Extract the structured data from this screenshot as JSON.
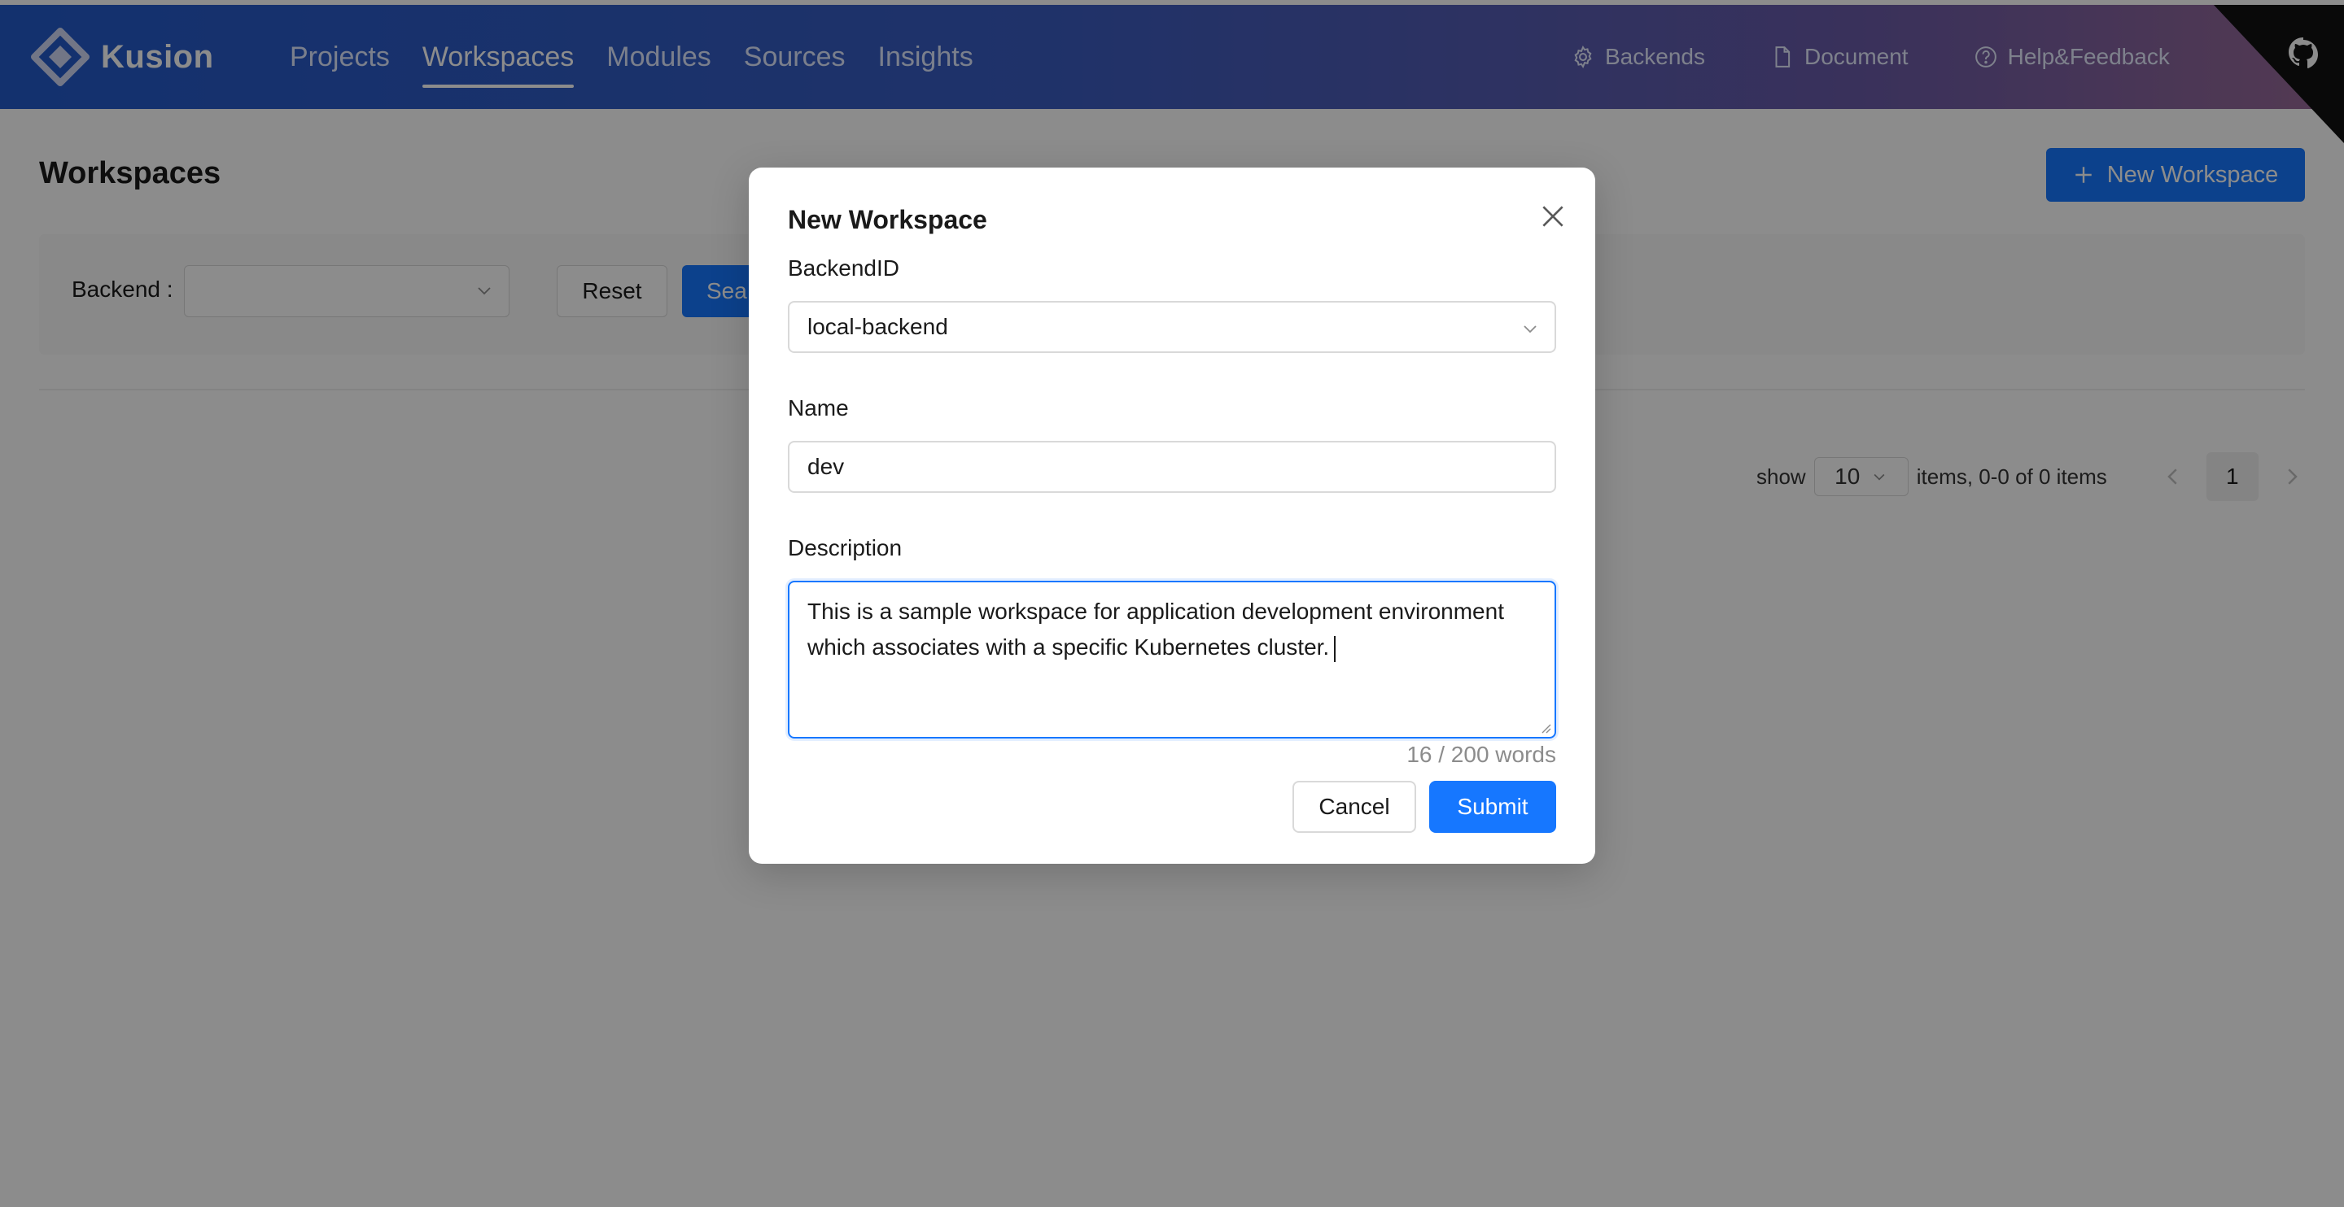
{
  "app": {
    "logo_text": "Kusion"
  },
  "nav": {
    "items": [
      {
        "label": "Projects"
      },
      {
        "label": "Workspaces"
      },
      {
        "label": "Modules"
      },
      {
        "label": "Sources"
      },
      {
        "label": "Insights"
      }
    ],
    "active": "Workspaces"
  },
  "header_right": {
    "backends": {
      "label": "Backends",
      "icon": "gear-icon"
    },
    "document": {
      "label": "Document",
      "icon": "document-icon"
    },
    "help": {
      "label": "Help&Feedback",
      "icon": "question-circle-icon"
    }
  },
  "page": {
    "title": "Workspaces",
    "new_button_label": "New Workspace"
  },
  "filter": {
    "backend_label": "Backend",
    "backend_value": "",
    "reset_label": "Reset",
    "search_label": "Sea"
  },
  "pagination": {
    "show_label": "show",
    "page_size": "10",
    "info": "items, 0-0 of 0 items",
    "current_page": "1"
  },
  "modal": {
    "title": "New Workspace",
    "backend_id_label": "BackendID",
    "backend_id_value": "local-backend",
    "name_label": "Name",
    "name_value": "dev",
    "description_label": "Description",
    "description_value": "This is a sample workspace for application development environment which associates with a specific Kubernetes cluster.",
    "word_count": "16 / 200 words",
    "cancel_label": "Cancel",
    "submit_label": "Submit"
  },
  "colors": {
    "primary": "#1677ff",
    "header_start": "#2359c9",
    "header_end": "#9a6a96"
  }
}
